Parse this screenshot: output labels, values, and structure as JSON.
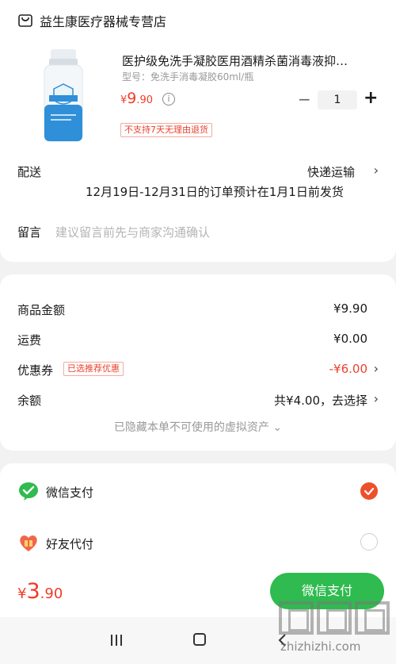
{
  "shop": {
    "name": "益生康医疗器械专营店"
  },
  "product": {
    "title": "医护级免洗手凝胶医用酒精杀菌消毒液抑…",
    "spec": "型号：免洗手消毒凝胶60ml/瓶",
    "price_yen": "¥",
    "price_int": "9",
    "price_dec": ".90",
    "quantity": "1",
    "tag": "不支持7天无理由退货"
  },
  "delivery": {
    "label": "配送",
    "value": "快递运输",
    "note": "12月19日-12月31日的订单预计在1月1日前发货"
  },
  "message": {
    "label": "留言",
    "placeholder": "建议留言前先与商家沟通确认"
  },
  "summary": {
    "goods_label": "商品金额",
    "goods_value": "¥9.90",
    "shipping_label": "运费",
    "shipping_value": "¥0.00",
    "coupon_label": "优惠券",
    "coupon_badge": "已选推荐优惠",
    "coupon_value": "-¥6.00",
    "balance_label": "余额",
    "balance_value": "共¥4.00，去选择",
    "hidden_note": "已隐藏本单不可使用的虚拟资产 ⌄"
  },
  "payment": {
    "options": [
      {
        "label": "微信支付",
        "selected": true
      },
      {
        "label": "好友代付",
        "selected": false
      }
    ]
  },
  "bottom": {
    "total_yen": "¥",
    "total_int": "3",
    "total_dec": ".90",
    "pay_button": "微信支付"
  },
  "watermark": {
    "text": "zhizhizhi.com"
  },
  "colors": {
    "accent_red": "#f03c2a",
    "wechat_green": "#2fbb4f",
    "radio_orange": "#ee4f2b"
  }
}
